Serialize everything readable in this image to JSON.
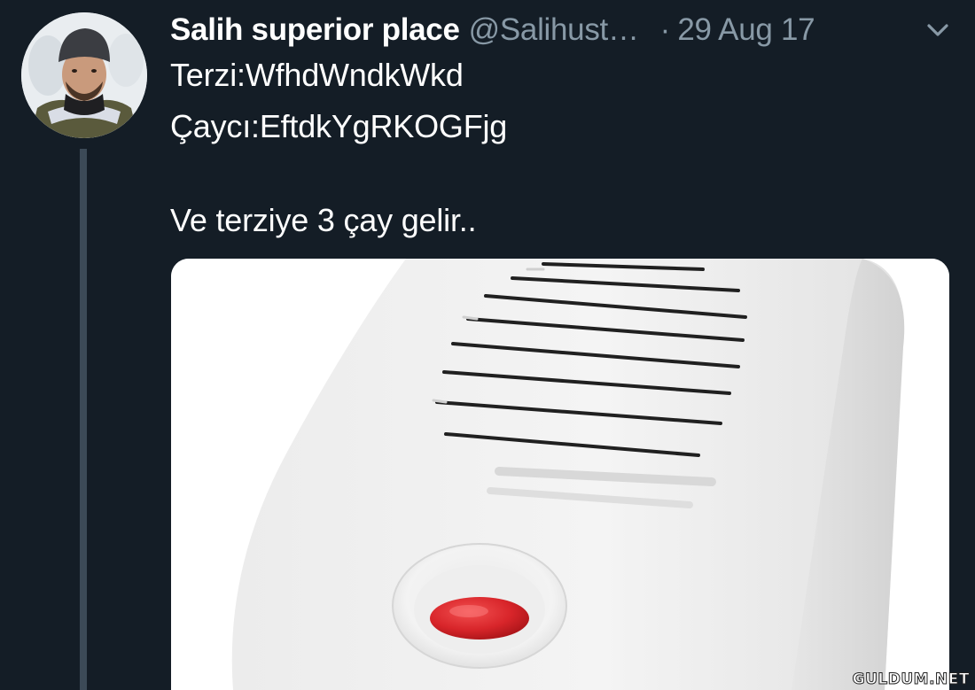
{
  "tweet": {
    "display_name": "Salih superior place",
    "handle": "@Salihust…",
    "separator": "·",
    "date": "29 Aug 17",
    "text_lines": [
      "Terzi:WfhdWndkWkd",
      "Çaycı:EftdkYgRKOGFjg",
      "Ve terziye 3 çay gelir.."
    ],
    "menu_icon": "chevron-down-icon",
    "media_description_icon": "doorbell-speaker-image"
  },
  "watermark": {
    "text": "GULDUM.NET"
  },
  "colors": {
    "background": "#141d26",
    "secondary_text": "#8899a6",
    "thread_line": "#3c4a57",
    "button_red": "#d8252a"
  }
}
